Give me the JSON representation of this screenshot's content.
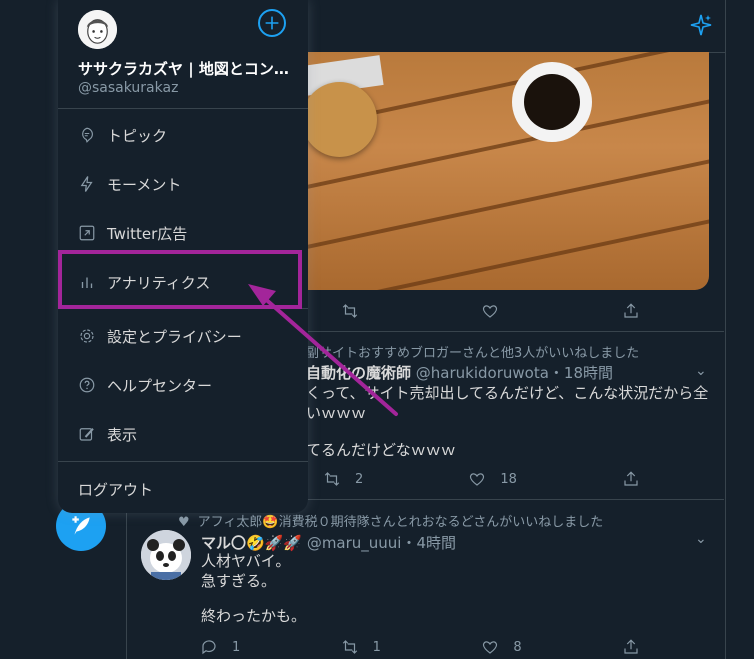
{
  "account": {
    "name": "ササクラカズヤ | 地図とコン…",
    "handle": "@sasakurakaz"
  },
  "menu": {
    "items": [
      {
        "label": "トピック"
      },
      {
        "label": "モーメント"
      },
      {
        "label": "Twitter広告"
      },
      {
        "label": "アナリティクス"
      },
      {
        "label": "設定とプライバシー"
      },
      {
        "label": "ヘルプセンター"
      },
      {
        "label": "表示"
      }
    ],
    "logout": "ログアウト"
  },
  "tweets": [
    {
      "context": "副サイトおすすめブロガーさんと他3人がいいねしました",
      "name": "自動化の魔術師",
      "handle": "@harukidoruwota",
      "time": "・18時間",
      "lines": [
        "くって、サイト売却出してるんだけど、こんな状況だから全",
        "いｗｗｗ",
        "",
        "てるんだけどなｗｗｗ"
      ],
      "retweets": "2",
      "likes": "18"
    },
    {
      "context": "アフィ太郎🤩消費税０期待隊さんとれおなるどさんがいいねしました",
      "name": "マル〇🤣🚀🚀",
      "handle": "@maru_uuui",
      "time": "・4時間",
      "lines": [
        "人材ヤバイ。",
        "急すぎる。",
        "",
        "終わったかも。"
      ],
      "replies": "1",
      "retweets": "1",
      "likes": "8"
    }
  ],
  "colors": {
    "accent": "#1da1f2",
    "highlight": "#a3259a",
    "background": "#15202b"
  }
}
